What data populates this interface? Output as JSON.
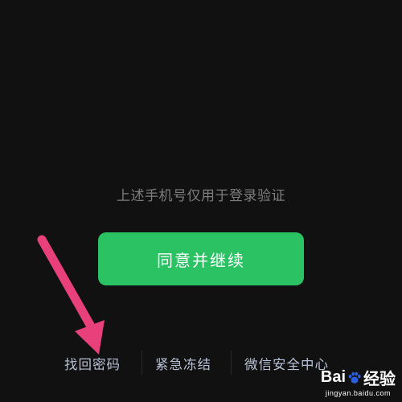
{
  "screen": {
    "hint_text": "上述手机号仅用于登录验证",
    "agree_button_label": "同意并继续"
  },
  "bottom_links": {
    "find_password": "找回密码",
    "emergency_freeze": "紧急冻结",
    "wechat_security_center": "微信安全中心"
  },
  "watermark": {
    "brand_left": "Bai",
    "brand_right": "经验",
    "site": "jingyan.baidu.com"
  },
  "colors": {
    "background": "#111111",
    "primary_button": "#2bc264",
    "link_text": "#b7c1d6",
    "hint_text": "#7d7d7d",
    "annotation_arrow": "#e8407a"
  },
  "icons": [
    "annotation-arrow-icon",
    "baidu-paw-icon"
  ]
}
